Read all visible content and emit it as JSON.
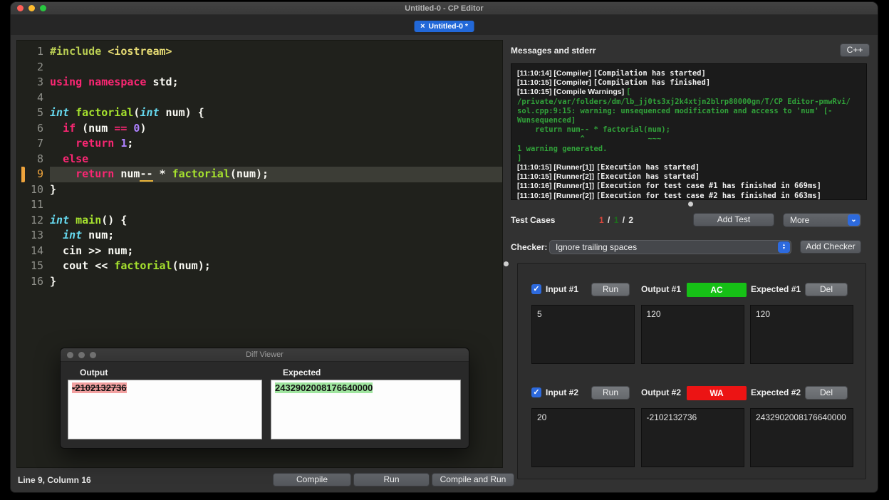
{
  "window": {
    "title": "Untitled-0 - CP Editor"
  },
  "tab": {
    "close_icon": "×",
    "label": "Untitled-0 *"
  },
  "editor": {
    "current_line": 9,
    "lines": [
      {
        "n": "1",
        "tokens": [
          {
            "t": "#include ",
            "c": "pre"
          },
          {
            "t": "<iostream>",
            "c": "str"
          }
        ]
      },
      {
        "n": "2",
        "tokens": []
      },
      {
        "n": "3",
        "tokens": [
          {
            "t": "using namespace",
            "c": "kw"
          },
          {
            "t": " std;",
            "c": "pl"
          }
        ]
      },
      {
        "n": "4",
        "tokens": []
      },
      {
        "n": "5",
        "tokens": [
          {
            "t": "int",
            "c": "type"
          },
          {
            "t": " ",
            "c": "pl"
          },
          {
            "t": "factorial",
            "c": "fn"
          },
          {
            "t": "(",
            "c": "pl"
          },
          {
            "t": "int",
            "c": "type"
          },
          {
            "t": " num) {",
            "c": "pl"
          }
        ]
      },
      {
        "n": "6",
        "tokens": [
          {
            "t": "  ",
            "c": "pl"
          },
          {
            "t": "if",
            "c": "kw"
          },
          {
            "t": " (num ",
            "c": "pl"
          },
          {
            "t": "==",
            "c": "kw"
          },
          {
            "t": " ",
            "c": "pl"
          },
          {
            "t": "0",
            "c": "num"
          },
          {
            "t": ")",
            "c": "pl"
          }
        ]
      },
      {
        "n": "7",
        "tokens": [
          {
            "t": "    ",
            "c": "pl"
          },
          {
            "t": "return",
            "c": "kw"
          },
          {
            "t": " ",
            "c": "pl"
          },
          {
            "t": "1",
            "c": "num"
          },
          {
            "t": ";",
            "c": "pl"
          }
        ]
      },
      {
        "n": "8",
        "tokens": [
          {
            "t": "  ",
            "c": "pl"
          },
          {
            "t": "else",
            "c": "kw"
          }
        ]
      },
      {
        "n": "9",
        "tokens": [
          {
            "t": "    ",
            "c": "pl"
          },
          {
            "t": "return",
            "c": "kw"
          },
          {
            "t": " num",
            "c": "pl"
          },
          {
            "t": "--",
            "c": "pl warn"
          },
          {
            "t": " * ",
            "c": "pl"
          },
          {
            "t": "factorial",
            "c": "fn"
          },
          {
            "t": "(num);",
            "c": "pl"
          }
        ]
      },
      {
        "n": "10",
        "tokens": [
          {
            "t": "}",
            "c": "pl"
          }
        ]
      },
      {
        "n": "11",
        "tokens": []
      },
      {
        "n": "12",
        "tokens": [
          {
            "t": "int",
            "c": "type"
          },
          {
            "t": " ",
            "c": "pl"
          },
          {
            "t": "main",
            "c": "fn"
          },
          {
            "t": "() {",
            "c": "pl"
          }
        ]
      },
      {
        "n": "13",
        "tokens": [
          {
            "t": "  ",
            "c": "pl"
          },
          {
            "t": "int",
            "c": "type"
          },
          {
            "t": " num;",
            "c": "pl"
          }
        ]
      },
      {
        "n": "14",
        "tokens": [
          {
            "t": "  cin >> num;",
            "c": "pl"
          }
        ]
      },
      {
        "n": "15",
        "tokens": [
          {
            "t": "  cout << ",
            "c": "pl"
          },
          {
            "t": "factorial",
            "c": "fn"
          },
          {
            "t": "(num);",
            "c": "pl"
          }
        ]
      },
      {
        "n": "16",
        "tokens": [
          {
            "t": "}",
            "c": "pl"
          }
        ]
      }
    ],
    "status": "Line 9, Column 16",
    "buttons": {
      "compile": "Compile",
      "run": "Run",
      "compile_and_run": "Compile and Run"
    }
  },
  "messages": {
    "title": "Messages and stderr",
    "language_button": "C++",
    "lines": [
      {
        "head": "[11:10:14] [Compiler] ",
        "msg": "[Compilation has started]",
        "type": "info"
      },
      {
        "head": "[11:10:15] [Compiler] ",
        "msg": "[Compilation has finished]",
        "type": "info"
      },
      {
        "head": "[11:10:15] [Compile Warnings] ",
        "msg": "[",
        "type": "warn"
      },
      {
        "msg": "/private/var/folders/dm/lb_jj0ts3xj2k4xtjn2blrp80000gn/T/CP Editor-pmwRvi/",
        "type": "warn"
      },
      {
        "msg": "sol.cpp:9:15: warning: unsequenced modification and access to 'num' [-",
        "type": "warn"
      },
      {
        "msg": "Wunsequenced]",
        "type": "warn"
      },
      {
        "msg": "    return num-- * factorial(num);",
        "type": "warn"
      },
      {
        "msg": "              ^              ~~~",
        "type": "warn"
      },
      {
        "msg": "1 warning generated.",
        "type": "warn"
      },
      {
        "msg": "]",
        "type": "warn"
      },
      {
        "head": "[11:10:15] [Runner[1]] ",
        "msg": "[Execution has started]",
        "type": "info"
      },
      {
        "head": "[11:10:15] [Runner[2]] ",
        "msg": "[Execution has started]",
        "type": "info"
      },
      {
        "head": "[11:10:16] [Runner[1]] ",
        "msg": "[Execution for test case #1 has finished in 669ms]",
        "type": "info"
      },
      {
        "head": "[11:10:16] [Runner[2]] ",
        "msg": "[Execution for test case #2 has finished in 663ms]",
        "type": "info"
      }
    ]
  },
  "test_cases": {
    "label": "Test Cases",
    "counts": [
      {
        "text": "1",
        "color": "#d8463c"
      },
      {
        "text": " / ",
        "color": "#e8e8e8"
      },
      {
        "text": "1",
        "color": "#1d6e1d"
      },
      {
        "text": " / ",
        "color": "#e8e8e8"
      },
      {
        "text": "2",
        "color": "#e8e8e8"
      }
    ],
    "add_test_button": "Add Test",
    "more_dropdown": "More",
    "checker_label": "Checker:",
    "checker_value": "Ignore trailing spaces",
    "add_checker_button": "Add Checker",
    "check_icon": "✓",
    "cases": [
      {
        "input_label": "Input #1",
        "run_button": "Run",
        "output_label": "Output #1",
        "verdict": "AC",
        "verdict_color": "#16c016",
        "expected_label": "Expected #1",
        "del_button": "Del",
        "input_value": "5",
        "output_value": "120",
        "expected_value": "120",
        "checked": true
      },
      {
        "input_label": "Input #2",
        "run_button": "Run",
        "output_label": "Output #2",
        "verdict": "WA",
        "verdict_color": "#ec1414",
        "expected_label": "Expected #2",
        "del_button": "Del",
        "input_value": "20",
        "output_value": "-2102132736",
        "expected_value": "2432902008176640000",
        "checked": true
      }
    ]
  },
  "diff_viewer": {
    "title": "Diff Viewer",
    "output_label": "Output",
    "expected_label": "Expected",
    "output_value": "-2102132736",
    "expected_value": "2432902008176640000"
  }
}
